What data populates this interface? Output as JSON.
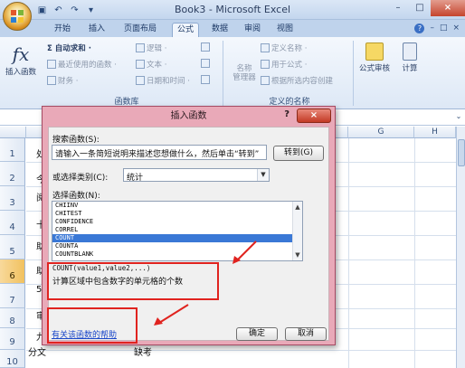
{
  "window": {
    "title": "Book3 - Microsoft Excel",
    "minimize": "–",
    "restore": "□",
    "close": "×"
  },
  "qat": {
    "save_icon": "save-icon",
    "undo_icon": "undo-icon",
    "redo_icon": "redo-icon"
  },
  "ribbon": {
    "tabs": [
      "开始",
      "插入",
      "页面布局",
      "公式",
      "数据",
      "审阅",
      "视图"
    ],
    "active_tab": "公式",
    "right_controls": [
      "?",
      "–",
      "□",
      "×"
    ],
    "insert_function": {
      "glyph": "fx",
      "label": "插入函数"
    },
    "library": {
      "autosum": "Σ 自动求和 ·",
      "recent": "最近使用的函数 ·",
      "financial": "财务 ·",
      "logical": "逻辑 ·",
      "text": "文本 ·",
      "datetime": "日期和时间 ·",
      "group_label": "函数库"
    },
    "names": {
      "name_manager": "名称\n管理器",
      "define": "定义名称 ·",
      "use_in_formula": "用于公式 ·",
      "create_from_sel": "根据所选内容创建",
      "group_label": "定义的名称"
    },
    "audit": {
      "label": "公式审核"
    },
    "calc": {
      "label": "计算"
    }
  },
  "sheet": {
    "columns": [
      "G",
      "H"
    ],
    "rows": [
      "1",
      "2",
      "3",
      "4",
      "5",
      "6",
      "7",
      "8",
      "9",
      "10"
    ],
    "selected_row": "6",
    "row_fragments": [
      "处",
      "今",
      "阅",
      "十",
      "助",
      "助",
      "5",
      "审",
      "九"
    ],
    "row10_a": "分文",
    "row10_b": "缺考"
  },
  "dialog": {
    "title": "插入函数",
    "help": "?",
    "close": "×",
    "search_label": "搜索函数(S):",
    "search_value": "请输入一条简短说明来描述您想做什么，然后单击“转到”",
    "go_button": "转到(G)",
    "category_label": "或选择类别(C):",
    "category_value": "统计",
    "select_label": "选择函数(N):",
    "functions": [
      "CHIINV",
      "CHITEST",
      "CONFIDENCE",
      "CORREL",
      "COUNT",
      "COUNTA",
      "COUNTBLANK"
    ],
    "selected_function": "COUNT",
    "syntax": "COUNT(value1,value2,...)",
    "description": "计算区域中包含数字的单元格的个数",
    "help_link": "有关该函数的帮助",
    "ok": "确定",
    "cancel": "取消"
  },
  "colors": {
    "accent_red": "#e0231f",
    "dialog_frame": "#e9a9b8",
    "selection_blue": "#3a78d6",
    "ribbon_blue": "#bfd3ec"
  }
}
